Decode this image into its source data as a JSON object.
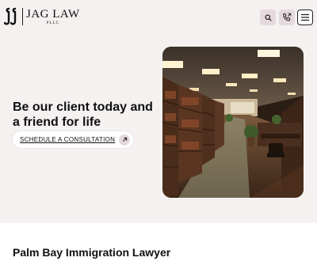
{
  "header": {
    "logo": {
      "name": "JAG LAW",
      "sub": "PLLC"
    },
    "icons": {
      "search": "search-icon",
      "phone": "phone-icon",
      "menu": "hamburger-menu-icon"
    }
  },
  "hero": {
    "title": "Be our client today and a friend for life",
    "cta_label": "SCHEDULE A CONSULTATION",
    "cta_icon": "arrow-up-right-icon",
    "image_alt": "law library office interior"
  },
  "section": {
    "title": "Palm Bay Immigration Lawyer"
  },
  "colors": {
    "background": "#f4f1f0",
    "accent": "#e6d9de",
    "text": "#111111"
  }
}
